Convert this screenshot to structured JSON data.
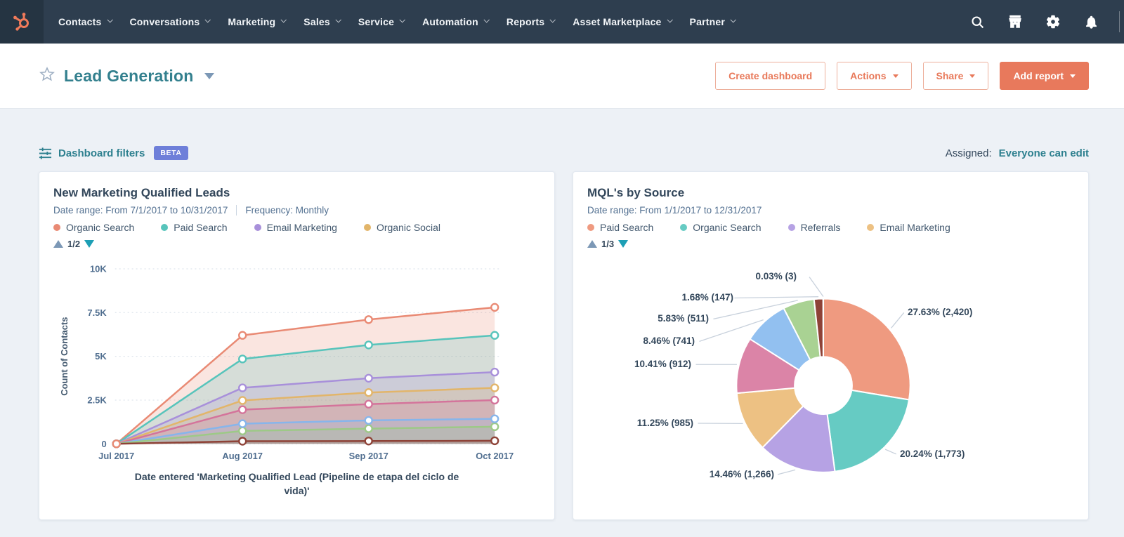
{
  "nav": {
    "items": [
      "Contacts",
      "Conversations",
      "Marketing",
      "Sales",
      "Service",
      "Automation",
      "Reports",
      "Asset Marketplace",
      "Partner"
    ],
    "right_icons": [
      "search-icon",
      "marketplace-icon",
      "settings-icon",
      "notifications-icon"
    ]
  },
  "header": {
    "title": "Lead Generation",
    "buttons": {
      "create_dashboard": "Create dashboard",
      "actions": "Actions",
      "share": "Share",
      "add_report": "Add report"
    }
  },
  "filters": {
    "label": "Dashboard filters",
    "badge": "BETA",
    "assigned_label": "Assigned:",
    "assigned_value": "Everyone can edit"
  },
  "cards": [
    {
      "date_range_text": "Date range: From 7/1/2017 to 10/31/2017",
      "frequency_text": "Frequency: Monthly",
      "legend_page": "1/2"
    },
    {
      "date_range_text": "Date range: From 1/1/2017 to 12/31/2017",
      "legend_page": "1/3"
    }
  ],
  "colors": {
    "navbar": "#2e3e4f",
    "accent_orange": "#e8795c",
    "teal_link": "#2e808f",
    "beta_badge": "#6e7fd9",
    "heading": "#33475b"
  },
  "chart_data": [
    {
      "type": "area",
      "title": "New Marketing Qualified Leads",
      "x": [
        "Jul 2017",
        "Aug 2017",
        "Sep 2017",
        "Oct 2017"
      ],
      "xlabel": "Date entered 'Marketing Qualified Lead (Pipeline de etapa del ciclo de vida)'",
      "ylabel": "Count of Contacts",
      "ylim": [
        0,
        10000
      ],
      "ytick_values": [
        0,
        2500,
        5000,
        7500,
        10000
      ],
      "ytick_labels": [
        "0",
        "2.5K",
        "5K",
        "7.5K",
        "10K"
      ],
      "grid": true,
      "legend_position": "top",
      "series": [
        {
          "name": "Organic Search",
          "color": "#e98a74",
          "values": [
            0,
            6200,
            7100,
            7800
          ]
        },
        {
          "name": "Paid Search",
          "color": "#57c4bb",
          "values": [
            0,
            4850,
            5650,
            6200
          ]
        },
        {
          "name": "Email Marketing",
          "color": "#a890da",
          "values": [
            0,
            3200,
            3750,
            4100
          ]
        },
        {
          "name": "Organic Social",
          "color": "#e2b56a",
          "values": [
            0,
            2480,
            2930,
            3200
          ]
        },
        {
          "name": "",
          "color": "#d4749b",
          "values": [
            0,
            1950,
            2270,
            2500
          ]
        },
        {
          "name": "",
          "color": "#87b5eb",
          "values": [
            0,
            1150,
            1340,
            1430
          ]
        },
        {
          "name": "",
          "color": "#9dc987",
          "values": [
            0,
            740,
            870,
            980
          ]
        },
        {
          "name": "",
          "color": "#8e4237",
          "values": [
            0,
            150,
            160,
            175
          ]
        }
      ]
    },
    {
      "type": "pie",
      "donut": true,
      "title": "MQL's by Source",
      "slices": [
        {
          "name": "Paid Search",
          "color": "#ef9a80",
          "value": 2420,
          "pct": 27.63,
          "label": "27.63% (2,420)"
        },
        {
          "name": "Organic Search",
          "color": "#66cbc3",
          "value": 1773,
          "pct": 20.24,
          "label": "20.24% (1,773)"
        },
        {
          "name": "Referrals",
          "color": "#b6a2e4",
          "value": 1266,
          "pct": 14.46,
          "label": "14.46% (1,266)"
        },
        {
          "name": "Email Marketing",
          "color": "#edc183",
          "value": 985,
          "pct": 11.25,
          "label": "11.25% (985)"
        },
        {
          "name": "",
          "color": "#db84a7",
          "value": 912,
          "pct": 10.41,
          "label": "10.41% (912)"
        },
        {
          "name": "",
          "color": "#92c0f0",
          "value": 741,
          "pct": 8.46,
          "label": "8.46% (741)"
        },
        {
          "name": "",
          "color": "#a9d293",
          "value": 511,
          "pct": 5.83,
          "label": "5.83% (511)"
        },
        {
          "name": "",
          "color": "#8e4237",
          "value": 147,
          "pct": 1.68,
          "label": "1.68% (147)"
        },
        {
          "name": "",
          "color": "#b0b8c1",
          "value": 3,
          "pct": 0.03,
          "label": "0.03% (3)"
        }
      ]
    }
  ]
}
